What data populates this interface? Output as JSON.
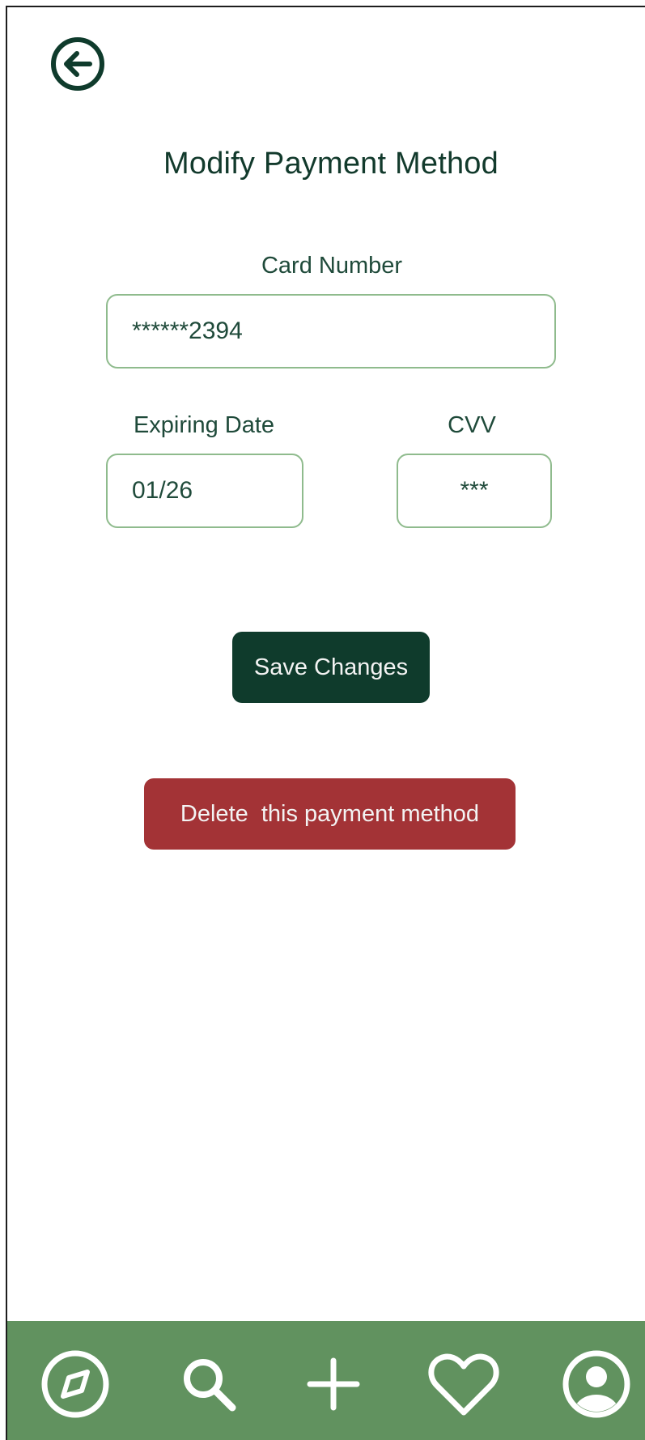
{
  "header": {
    "back_icon": "arrow-left-circle-icon",
    "title": "Modify Payment Method"
  },
  "form": {
    "card_number": {
      "label": "Card Number",
      "value": "******2394"
    },
    "expiry": {
      "label": "Expiring Date",
      "value": "01/26"
    },
    "cvv": {
      "label": "CVV",
      "value": "***"
    }
  },
  "actions": {
    "save_label": "Save Changes",
    "delete_label": "Delete  this payment method"
  },
  "tabbar": {
    "items": [
      {
        "icon": "compass-icon"
      },
      {
        "icon": "search-icon"
      },
      {
        "icon": "plus-icon"
      },
      {
        "icon": "heart-icon"
      },
      {
        "icon": "user-icon"
      }
    ]
  },
  "colors": {
    "primary_dark": "#0f3b2c",
    "danger": "#a33336",
    "field_border": "#8fbb8d",
    "tabbar_bg": "#61925f"
  }
}
